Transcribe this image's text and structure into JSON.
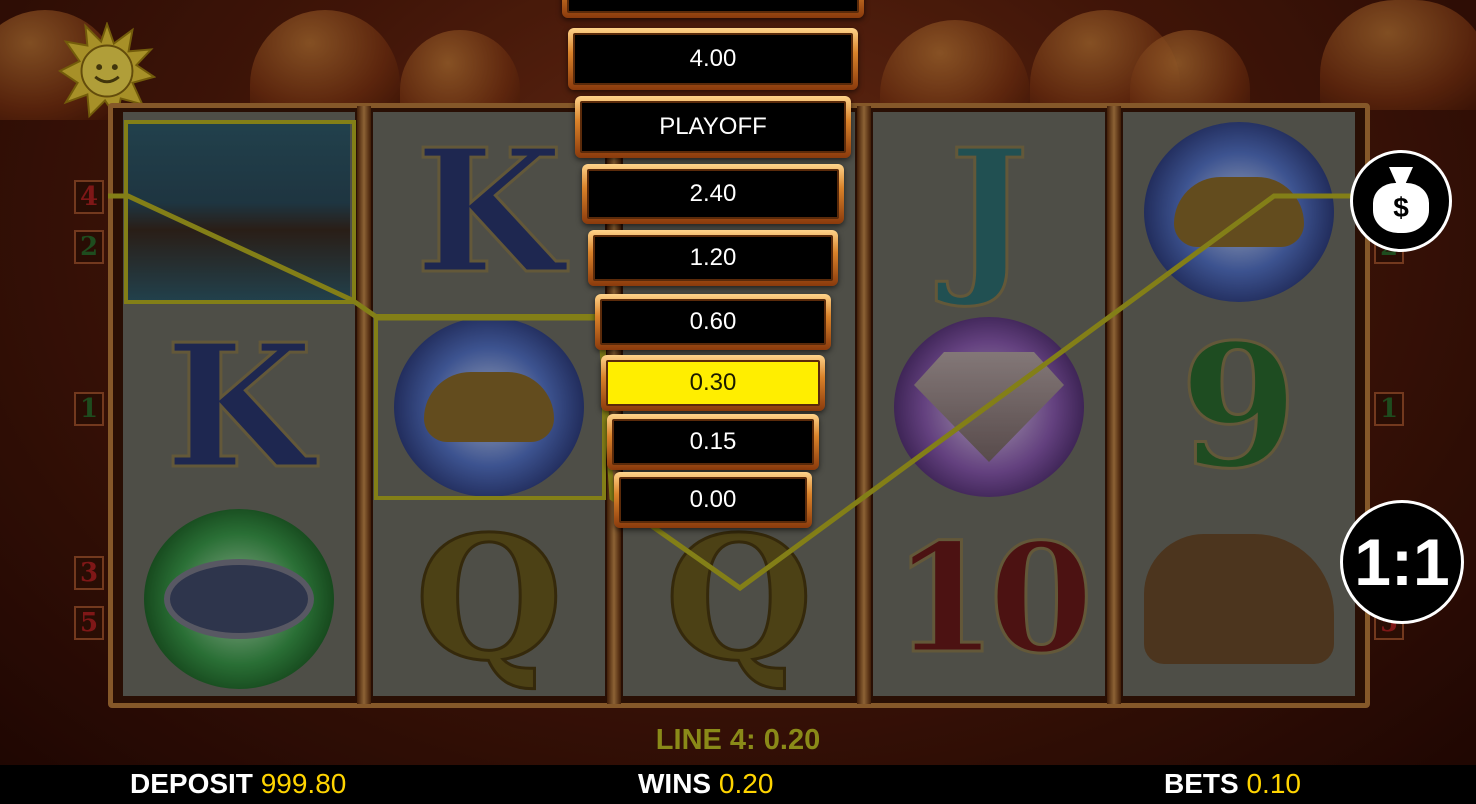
{
  "ladder": {
    "levels": [
      "4.00",
      "PLAYOFF",
      "2.40",
      "1.20",
      "0.60",
      "0.30",
      "0.15",
      "0.00"
    ],
    "active_index": 5
  },
  "line_numbers": {
    "left": [
      "4",
      "2",
      "1",
      "3",
      "5"
    ],
    "right": [
      "2",
      "1",
      "5"
    ]
  },
  "reels": [
    [
      "genie",
      "K",
      "bracelet"
    ],
    [
      "K",
      "lamp",
      "Q"
    ],
    [
      "",
      "",
      "Q"
    ],
    [
      "J",
      "diamond",
      "10"
    ],
    [
      "lamp",
      "9",
      "shoes"
    ]
  ],
  "reel_letters": {
    "r1_mid": "K",
    "r2_top": "K",
    "r2_bot": "Q",
    "r3_bot": "Q",
    "r4_top": "J",
    "r4_bot": "10",
    "r5_mid": "9"
  },
  "controls": {
    "collect_icon": "money-bag-icon",
    "collect_symbol": "$",
    "gamble_ratio": "1:1"
  },
  "win_message": "LINE 4: 0.20",
  "footer": {
    "deposit_label": "DEPOSIT",
    "deposit_value": "999.80",
    "wins_label": "WINS",
    "wins_value": "0.20",
    "bets_label": "BETS",
    "bets_value": "0.10"
  },
  "colors": {
    "highlight": "#ffee00",
    "value_yellow": "#ffd400",
    "win_line": "#b6b020"
  }
}
